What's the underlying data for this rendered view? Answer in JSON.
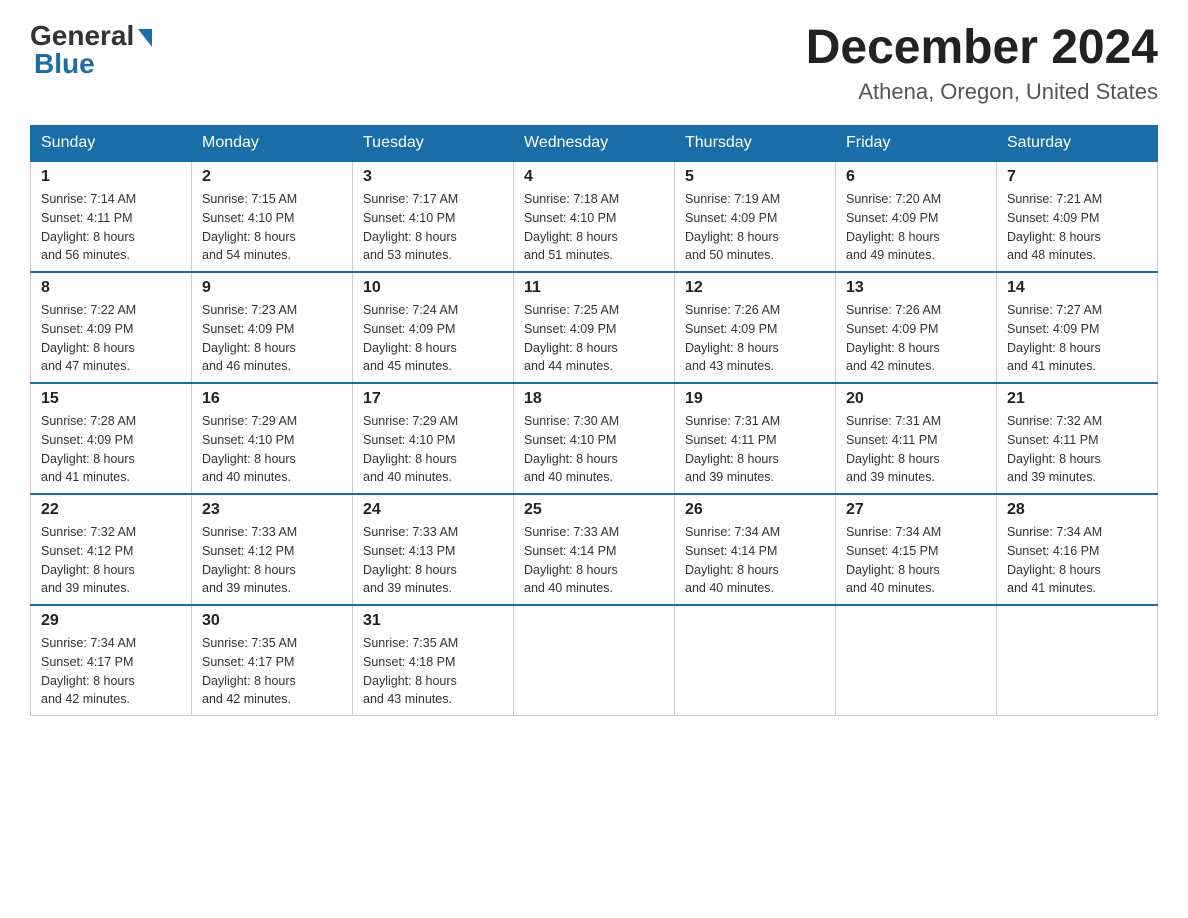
{
  "logo": {
    "general": "General",
    "blue": "Blue"
  },
  "title": "December 2024",
  "location": "Athena, Oregon, United States",
  "days_of_week": [
    "Sunday",
    "Monday",
    "Tuesday",
    "Wednesday",
    "Thursday",
    "Friday",
    "Saturday"
  ],
  "weeks": [
    [
      {
        "day": "1",
        "sunrise": "7:14 AM",
        "sunset": "4:11 PM",
        "daylight": "8 hours and 56 minutes."
      },
      {
        "day": "2",
        "sunrise": "7:15 AM",
        "sunset": "4:10 PM",
        "daylight": "8 hours and 54 minutes."
      },
      {
        "day": "3",
        "sunrise": "7:17 AM",
        "sunset": "4:10 PM",
        "daylight": "8 hours and 53 minutes."
      },
      {
        "day": "4",
        "sunrise": "7:18 AM",
        "sunset": "4:10 PM",
        "daylight": "8 hours and 51 minutes."
      },
      {
        "day": "5",
        "sunrise": "7:19 AM",
        "sunset": "4:09 PM",
        "daylight": "8 hours and 50 minutes."
      },
      {
        "day": "6",
        "sunrise": "7:20 AM",
        "sunset": "4:09 PM",
        "daylight": "8 hours and 49 minutes."
      },
      {
        "day": "7",
        "sunrise": "7:21 AM",
        "sunset": "4:09 PM",
        "daylight": "8 hours and 48 minutes."
      }
    ],
    [
      {
        "day": "8",
        "sunrise": "7:22 AM",
        "sunset": "4:09 PM",
        "daylight": "8 hours and 47 minutes."
      },
      {
        "day": "9",
        "sunrise": "7:23 AM",
        "sunset": "4:09 PM",
        "daylight": "8 hours and 46 minutes."
      },
      {
        "day": "10",
        "sunrise": "7:24 AM",
        "sunset": "4:09 PM",
        "daylight": "8 hours and 45 minutes."
      },
      {
        "day": "11",
        "sunrise": "7:25 AM",
        "sunset": "4:09 PM",
        "daylight": "8 hours and 44 minutes."
      },
      {
        "day": "12",
        "sunrise": "7:26 AM",
        "sunset": "4:09 PM",
        "daylight": "8 hours and 43 minutes."
      },
      {
        "day": "13",
        "sunrise": "7:26 AM",
        "sunset": "4:09 PM",
        "daylight": "8 hours and 42 minutes."
      },
      {
        "day": "14",
        "sunrise": "7:27 AM",
        "sunset": "4:09 PM",
        "daylight": "8 hours and 41 minutes."
      }
    ],
    [
      {
        "day": "15",
        "sunrise": "7:28 AM",
        "sunset": "4:09 PM",
        "daylight": "8 hours and 41 minutes."
      },
      {
        "day": "16",
        "sunrise": "7:29 AM",
        "sunset": "4:10 PM",
        "daylight": "8 hours and 40 minutes."
      },
      {
        "day": "17",
        "sunrise": "7:29 AM",
        "sunset": "4:10 PM",
        "daylight": "8 hours and 40 minutes."
      },
      {
        "day": "18",
        "sunrise": "7:30 AM",
        "sunset": "4:10 PM",
        "daylight": "8 hours and 40 minutes."
      },
      {
        "day": "19",
        "sunrise": "7:31 AM",
        "sunset": "4:11 PM",
        "daylight": "8 hours and 39 minutes."
      },
      {
        "day": "20",
        "sunrise": "7:31 AM",
        "sunset": "4:11 PM",
        "daylight": "8 hours and 39 minutes."
      },
      {
        "day": "21",
        "sunrise": "7:32 AM",
        "sunset": "4:11 PM",
        "daylight": "8 hours and 39 minutes."
      }
    ],
    [
      {
        "day": "22",
        "sunrise": "7:32 AM",
        "sunset": "4:12 PM",
        "daylight": "8 hours and 39 minutes."
      },
      {
        "day": "23",
        "sunrise": "7:33 AM",
        "sunset": "4:12 PM",
        "daylight": "8 hours and 39 minutes."
      },
      {
        "day": "24",
        "sunrise": "7:33 AM",
        "sunset": "4:13 PM",
        "daylight": "8 hours and 39 minutes."
      },
      {
        "day": "25",
        "sunrise": "7:33 AM",
        "sunset": "4:14 PM",
        "daylight": "8 hours and 40 minutes."
      },
      {
        "day": "26",
        "sunrise": "7:34 AM",
        "sunset": "4:14 PM",
        "daylight": "8 hours and 40 minutes."
      },
      {
        "day": "27",
        "sunrise": "7:34 AM",
        "sunset": "4:15 PM",
        "daylight": "8 hours and 40 minutes."
      },
      {
        "day": "28",
        "sunrise": "7:34 AM",
        "sunset": "4:16 PM",
        "daylight": "8 hours and 41 minutes."
      }
    ],
    [
      {
        "day": "29",
        "sunrise": "7:34 AM",
        "sunset": "4:17 PM",
        "daylight": "8 hours and 42 minutes."
      },
      {
        "day": "30",
        "sunrise": "7:35 AM",
        "sunset": "4:17 PM",
        "daylight": "8 hours and 42 minutes."
      },
      {
        "day": "31",
        "sunrise": "7:35 AM",
        "sunset": "4:18 PM",
        "daylight": "8 hours and 43 minutes."
      },
      null,
      null,
      null,
      null
    ]
  ],
  "labels": {
    "sunrise": "Sunrise: ",
    "sunset": "Sunset: ",
    "daylight": "Daylight: "
  }
}
